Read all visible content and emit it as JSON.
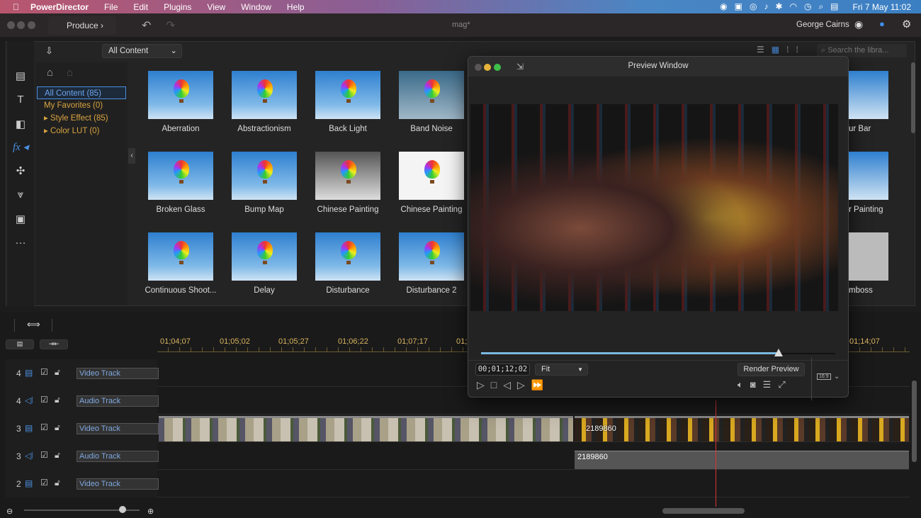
{
  "menubar": {
    "app": "PowerDirector",
    "items": [
      "File",
      "Edit",
      "Plugins",
      "View",
      "Window",
      "Help"
    ],
    "clock": "Fri 7 May  11:02"
  },
  "titlebar": {
    "produce": "Produce",
    "project": "mag*",
    "user": "George Cairns"
  },
  "library": {
    "filter": "All Content",
    "search_placeholder": "Search the libra...",
    "tree": [
      "All Content (85)",
      "My Favorites (0)",
      "Style Effect (85)",
      "Color LUT (0)"
    ],
    "effects": [
      [
        "Aberration",
        "Abstractionism",
        "Back Light",
        "Band Noise"
      ],
      [
        "Broken Glass",
        "Bump Map",
        "Chinese Painting",
        "Chinese Painting"
      ],
      [
        "Continuous Shoot...",
        "Delay",
        "Disturbance",
        "Disturbance 2"
      ]
    ],
    "partial": [
      "ur Bar",
      "r Painting",
      "mboss"
    ]
  },
  "preview": {
    "title": "Preview Window",
    "timecode": "00;01;12;02",
    "zoom": "Fit",
    "render": "Render Preview",
    "aspect": "16:9",
    "progress": 0.84
  },
  "timeline": {
    "ruler": [
      "01;04;07",
      "01;05;02",
      "01;05;27",
      "01;06;22",
      "01;07;17",
      "01;",
      "01;14;07"
    ],
    "tracks": [
      {
        "num": "4",
        "type": "video",
        "name": "Video Track"
      },
      {
        "num": "4",
        "type": "audio",
        "name": "Audio Track"
      },
      {
        "num": "3",
        "type": "video",
        "name": "Video Track"
      },
      {
        "num": "3",
        "type": "audio",
        "name": "Audio Track"
      },
      {
        "num": "2",
        "type": "video",
        "name": "Video Track"
      }
    ],
    "clip_label": "2189860",
    "audio_clip_label": "2189860",
    "zoom_level": 0.85
  },
  "colors": {
    "accent": "#4a90e2",
    "timecode": "#d9b560",
    "folder": "#d9a441",
    "playhead": "#d33"
  }
}
